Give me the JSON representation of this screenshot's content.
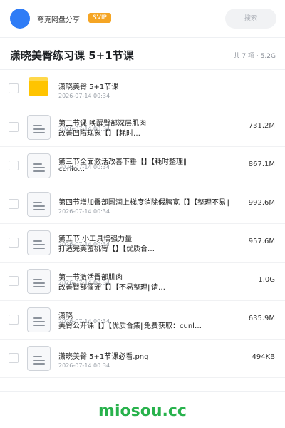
{
  "header": {
    "user_name": "夸克网盘分享",
    "badge": "SVIP",
    "search_placeholder": "搜索"
  },
  "folder": {
    "title": "潇晓美臀练习课 5+1节课",
    "meta": "共 7 项 · 5.2G"
  },
  "files": [
    {
      "type": "folder",
      "icon": "folder-icon",
      "name": "潇晓美臀 5+1节课",
      "sub": "",
      "date": "2026-07-14 00:34",
      "size": ""
    },
    {
      "type": "file",
      "icon": "document-icon",
      "name": "第二节课 唤醒臀部深层肌肉",
      "sub": "改善凹陷现象【】【耗时…",
      "date": "2026-07-14 00:34",
      "size": "731.2M"
    },
    {
      "type": "file",
      "icon": "document-icon",
      "name": "第三节全面激活改善下垂【】【耗时整理‖",
      "sub": "cunlo…",
      "date": "2026-07-14 00:34",
      "size": "867.1M"
    },
    {
      "type": "file",
      "icon": "document-icon",
      "name": "第四节增加臀部圆润上梯度消除假胯宽【】【整理不易‖",
      "sub": "",
      "date": "2026-07-14 00:34",
      "size": "992.6M"
    },
    {
      "type": "file",
      "icon": "document-icon",
      "name": "第五节 小工具增强力量",
      "sub": "打造完美蜜桃臀【】【优质合…",
      "date": "2026-07-14 00:34",
      "size": "957.6M"
    },
    {
      "type": "file",
      "icon": "document-icon",
      "name": "第一节激活臀部肌肉",
      "sub": "改善臀部僵硬【】【不易整理‖请…",
      "date": "2026-07-14 00:34",
      "size": "1.0G"
    },
    {
      "type": "file",
      "icon": "document-icon",
      "name": "潇晓",
      "sub": "美臀公开课【】【优质合集‖免费获取：cunl…",
      "date": "2026-07-14 00:34",
      "size": "635.9M"
    },
    {
      "type": "file",
      "icon": "document-icon",
      "name": "潇晓美臀 5+1节课必看.png",
      "sub": "",
      "date": "2026-07-14 00:34",
      "size": "494KB"
    }
  ],
  "footer": {
    "brand": "miosou.cc"
  },
  "colors": {
    "accent": "#2f7cf6",
    "svip": "#f5a524",
    "folder": "#ffc400",
    "brand": "#28b24c"
  }
}
